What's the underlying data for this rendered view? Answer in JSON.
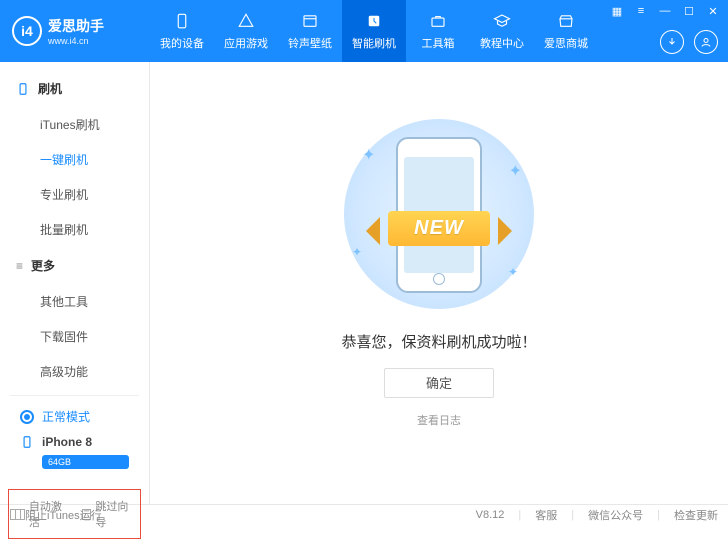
{
  "logo": {
    "badge": "i4",
    "name": "爱思助手",
    "url": "www.i4.cn"
  },
  "tabs": [
    {
      "label": "我的设备"
    },
    {
      "label": "应用游戏"
    },
    {
      "label": "铃声壁纸"
    },
    {
      "label": "智能刷机"
    },
    {
      "label": "工具箱"
    },
    {
      "label": "教程中心"
    },
    {
      "label": "爱思商城"
    }
  ],
  "sidebar": {
    "group1": "刷机",
    "items1": [
      "iTunes刷机",
      "一键刷机",
      "专业刷机",
      "批量刷机"
    ],
    "group2": "更多",
    "items2": [
      "其他工具",
      "下载固件",
      "高级功能"
    ]
  },
  "mode": "正常模式",
  "device": {
    "name": "iPhone 8",
    "storage": "64GB"
  },
  "options": {
    "auto": "自动激活",
    "skip": "跳过向导"
  },
  "main": {
    "ribbon": "NEW",
    "message": "恭喜您，保资料刷机成功啦！",
    "ok": "确定",
    "log": "查看日志"
  },
  "footer": {
    "block": "阻止iTunes运行",
    "version": "V8.12",
    "support": "客服",
    "wechat": "微信公众号",
    "update": "检查更新"
  }
}
